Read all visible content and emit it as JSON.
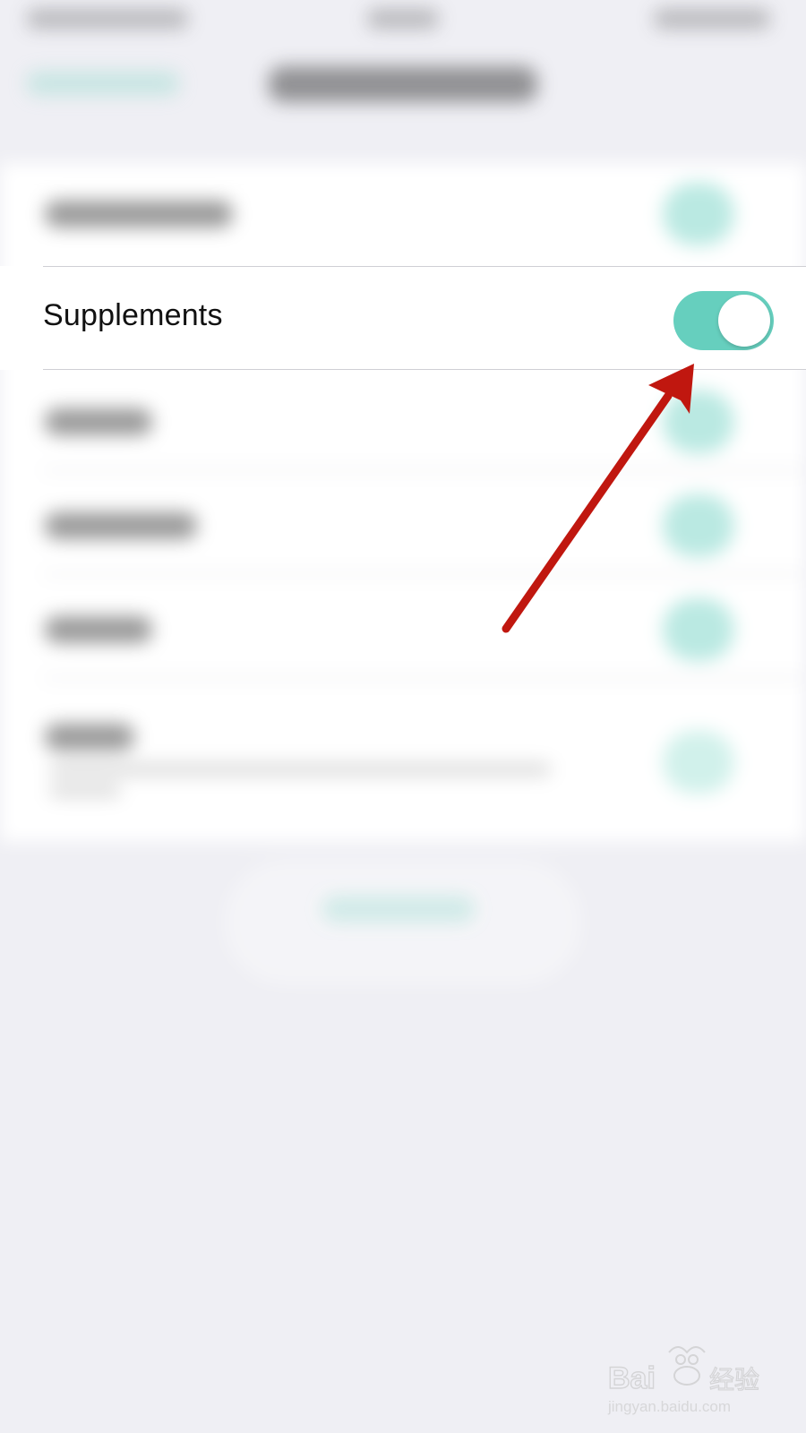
{
  "settings": {
    "focused_row": {
      "label": "Supplements",
      "toggle_on": true
    }
  },
  "colors": {
    "accent": "#66cfbe",
    "background": "#efeff4",
    "annotation_arrow": "#c0170f"
  },
  "watermark": {
    "text": "Baidu 经验",
    "url_text": "jingyan.baidu.com"
  }
}
